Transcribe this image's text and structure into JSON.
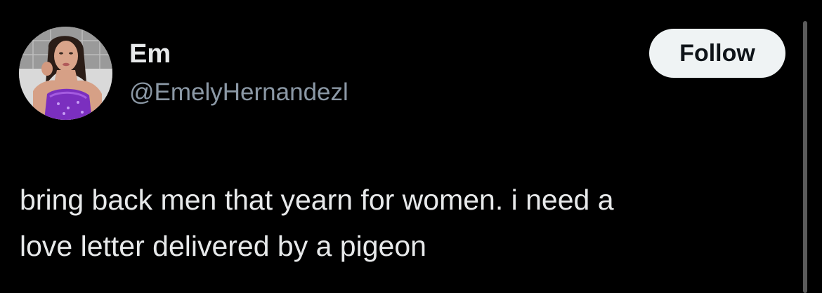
{
  "author": {
    "display_name": "Em",
    "handle": "@EmelyHernandezl",
    "avatar_icon": "profile-photo"
  },
  "actions": {
    "follow_label": "Follow"
  },
  "tweet": {
    "text_line_1": "bring back men that yearn for women. i need a",
    "text_line_2": "love letter delivered by a pigeon"
  },
  "colors": {
    "background": "#000000",
    "primary_text": "#e7e9ea",
    "secondary_text": "#8b98a5",
    "follow_button_bg": "#eff3f4",
    "follow_button_text": "#0f1419"
  }
}
